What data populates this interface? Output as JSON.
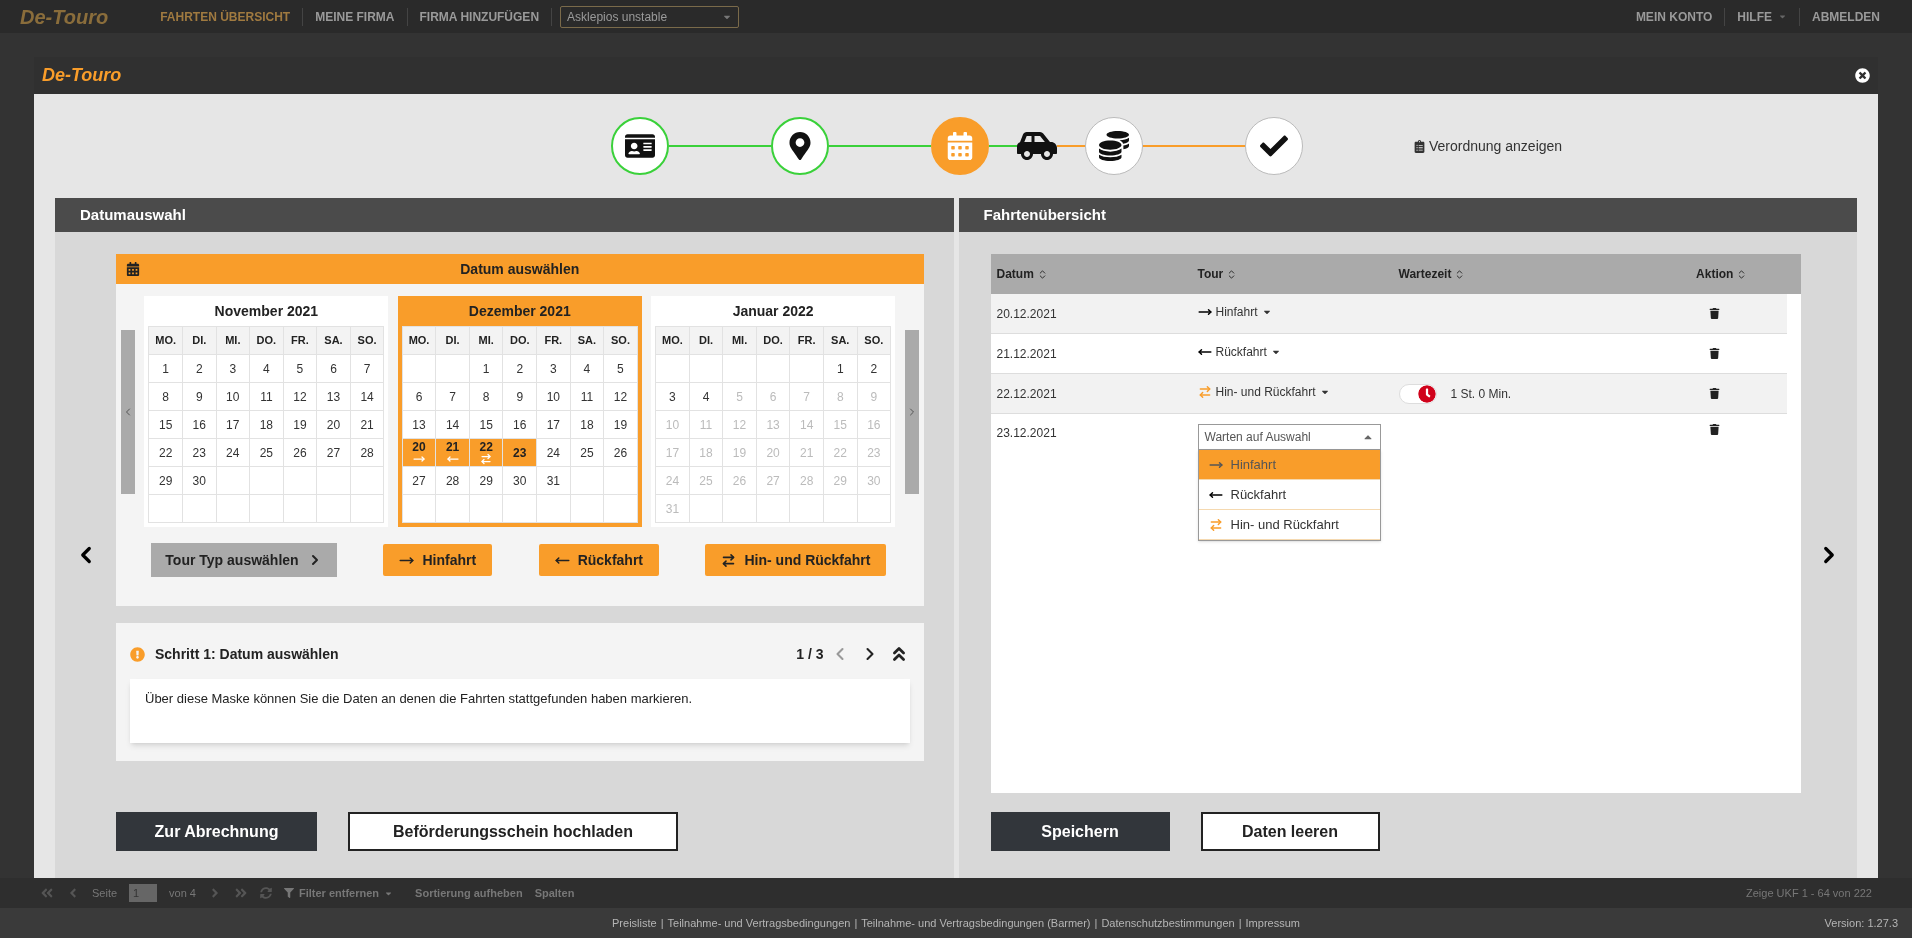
{
  "top_nav": {
    "logo": "De-Touro",
    "links": [
      {
        "label": "FAHRTEN ÜBERSICHT",
        "selected": true
      },
      {
        "label": "MEINE FIRMA",
        "selected": false
      },
      {
        "label": "FIRMA HINZUFÜGEN",
        "selected": false
      }
    ],
    "tenant_select": {
      "value": "Asklepios unstable"
    },
    "right_links": [
      {
        "label": "MEIN KONTO",
        "has_menu": false
      },
      {
        "label": "HILFE",
        "has_menu": true
      },
      {
        "label": "ABMELDEN",
        "has_menu": false
      }
    ]
  },
  "modal": {
    "logo": "De-Touro",
    "stepper": [
      {
        "kind": "circle",
        "done": true,
        "current": false
      },
      {
        "kind": "circle",
        "done": true,
        "current": false
      },
      {
        "kind": "circle",
        "done": false,
        "current": true
      },
      {
        "kind": "plain",
        "done": false,
        "current": true
      },
      {
        "kind": "circle",
        "done": false,
        "current": false
      },
      {
        "kind": "circle",
        "done": false,
        "current": false
      }
    ],
    "prescription_link": "Verordnung anzeigen",
    "left_panel": {
      "title": "Datumauswahl",
      "calendar_title": "Datum auswählen",
      "months": [
        {
          "title": "November 2021",
          "selected": false,
          "weekdays": [
            "MO.",
            "DI.",
            "MI.",
            "DO.",
            "FR.",
            "SA.",
            "SO."
          ],
          "weeks": [
            [
              {
                "kind": "day",
                "day": "1",
                "selected": false,
                "disabled": false
              },
              {
                "kind": "day",
                "day": "2",
                "selected": false,
                "disabled": false
              },
              {
                "kind": "day",
                "day": "3",
                "selected": false,
                "disabled": false
              },
              {
                "kind": "day",
                "day": "4",
                "selected": false,
                "disabled": false
              },
              {
                "kind": "day",
                "day": "5",
                "selected": false,
                "disabled": false
              },
              {
                "kind": "day",
                "day": "6",
                "selected": false,
                "disabled": false
              },
              {
                "kind": "day",
                "day": "7",
                "selected": false,
                "disabled": false
              }
            ],
            [
              {
                "kind": "day",
                "day": "8",
                "selected": false,
                "disabled": false
              },
              {
                "kind": "day",
                "day": "9",
                "selected": false,
                "disabled": false
              },
              {
                "kind": "day",
                "day": "10",
                "selected": false,
                "disabled": false
              },
              {
                "kind": "day",
                "day": "11",
                "selected": false,
                "disabled": false
              },
              {
                "kind": "day",
                "day": "12",
                "selected": false,
                "disabled": false
              },
              {
                "kind": "day",
                "day": "13",
                "selected": false,
                "disabled": false
              },
              {
                "kind": "day",
                "day": "14",
                "selected": false,
                "disabled": false
              }
            ],
            [
              {
                "kind": "day",
                "day": "15",
                "selected": false,
                "disabled": false
              },
              {
                "kind": "day",
                "day": "16",
                "selected": false,
                "disabled": false
              },
              {
                "kind": "day",
                "day": "17",
                "selected": false,
                "disabled": false
              },
              {
                "kind": "day",
                "day": "18",
                "selected": false,
                "disabled": false
              },
              {
                "kind": "day",
                "day": "19",
                "selected": false,
                "disabled": false
              },
              {
                "kind": "day",
                "day": "20",
                "selected": false,
                "disabled": false
              },
              {
                "kind": "day",
                "day": "21",
                "selected": false,
                "disabled": false
              }
            ],
            [
              {
                "kind": "day",
                "day": "22",
                "selected": false,
                "disabled": false
              },
              {
                "kind": "day",
                "day": "23",
                "selected": false,
                "disabled": false
              },
              {
                "kind": "day",
                "day": "24",
                "selected": false,
                "disabled": false
              },
              {
                "kind": "day",
                "day": "25",
                "selected": false,
                "disabled": false
              },
              {
                "kind": "day",
                "day": "26",
                "selected": false,
                "disabled": false
              },
              {
                "kind": "day",
                "day": "27",
                "selected": false,
                "disabled": false
              },
              {
                "kind": "day",
                "day": "28",
                "selected": false,
                "disabled": false
              }
            ],
            [
              {
                "kind": "day",
                "day": "29",
                "selected": false,
                "disabled": false
              },
              {
                "kind": "day",
                "day": "30",
                "selected": false,
                "disabled": false
              },
              {
                "kind": "blank"
              },
              {
                "kind": "blank"
              },
              {
                "kind": "blank"
              },
              {
                "kind": "blank"
              },
              {
                "kind": "blank"
              }
            ],
            [
              {
                "kind": "blank"
              },
              {
                "kind": "blank"
              },
              {
                "kind": "blank"
              },
              {
                "kind": "blank"
              },
              {
                "kind": "blank"
              },
              {
                "kind": "blank"
              },
              {
                "kind": "blank"
              }
            ]
          ]
        },
        {
          "title": "Dezember 2021",
          "selected": true,
          "weekdays": [
            "MO.",
            "DI.",
            "MI.",
            "DO.",
            "FR.",
            "SA.",
            "SO."
          ],
          "weeks": [
            [
              {
                "kind": "blank"
              },
              {
                "kind": "blank"
              },
              {
                "kind": "day",
                "day": "1",
                "selected": false,
                "disabled": false
              },
              {
                "kind": "day",
                "day": "2",
                "selected": false,
                "disabled": false
              },
              {
                "kind": "day",
                "day": "3",
                "selected": false,
                "disabled": false
              },
              {
                "kind": "day",
                "day": "4",
                "selected": false,
                "disabled": false
              },
              {
                "kind": "day",
                "day": "5",
                "selected": false,
                "disabled": false
              }
            ],
            [
              {
                "kind": "day",
                "day": "6",
                "selected": false,
                "disabled": false
              },
              {
                "kind": "day",
                "day": "7",
                "selected": false,
                "disabled": false
              },
              {
                "kind": "day",
                "day": "8",
                "selected": false,
                "disabled": false
              },
              {
                "kind": "day",
                "day": "9",
                "selected": false,
                "disabled": false
              },
              {
                "kind": "day",
                "day": "10",
                "selected": false,
                "disabled": false
              },
              {
                "kind": "day",
                "day": "11",
                "selected": false,
                "disabled": false
              },
              {
                "kind": "day",
                "day": "12",
                "selected": false,
                "disabled": false
              }
            ],
            [
              {
                "kind": "day",
                "day": "13",
                "selected": false,
                "disabled": false
              },
              {
                "kind": "day",
                "day": "14",
                "selected": false,
                "disabled": false
              },
              {
                "kind": "day",
                "day": "15",
                "selected": false,
                "disabled": false
              },
              {
                "kind": "day",
                "day": "16",
                "selected": false,
                "disabled": false
              },
              {
                "kind": "day",
                "day": "17",
                "selected": false,
                "disabled": false
              },
              {
                "kind": "day",
                "day": "18",
                "selected": false,
                "disabled": false
              },
              {
                "kind": "day",
                "day": "19",
                "selected": false,
                "disabled": false
              }
            ],
            [
              {
                "kind": "outbound",
                "day": "20",
                "selected": true,
                "disabled": false
              },
              {
                "kind": "return",
                "day": "21",
                "selected": true,
                "disabled": false
              },
              {
                "kind": "both",
                "day": "22",
                "selected": true,
                "disabled": false
              },
              {
                "kind": "day",
                "day": "23",
                "selected": true,
                "disabled": false
              },
              {
                "kind": "day",
                "day": "24",
                "selected": false,
                "disabled": false
              },
              {
                "kind": "day",
                "day": "25",
                "selected": false,
                "disabled": false
              },
              {
                "kind": "day",
                "day": "26",
                "selected": false,
                "disabled": false
              }
            ],
            [
              {
                "kind": "day",
                "day": "27",
                "selected": false,
                "disabled": false
              },
              {
                "kind": "day",
                "day": "28",
                "selected": false,
                "disabled": false
              },
              {
                "kind": "day",
                "day": "29",
                "selected": false,
                "disabled": false
              },
              {
                "kind": "day",
                "day": "30",
                "selected": false,
                "disabled": false
              },
              {
                "kind": "day",
                "day": "31",
                "selected": false,
                "disabled": false
              },
              {
                "kind": "blank"
              },
              {
                "kind": "blank"
              }
            ],
            [
              {
                "kind": "blank"
              },
              {
                "kind": "blank"
              },
              {
                "kind": "blank"
              },
              {
                "kind": "blank"
              },
              {
                "kind": "blank"
              },
              {
                "kind": "blank"
              },
              {
                "kind": "blank"
              }
            ]
          ]
        },
        {
          "title": "Januar 2022",
          "selected": false,
          "weekdays": [
            "MO.",
            "DI.",
            "MI.",
            "DO.",
            "FR.",
            "SA.",
            "SO."
          ],
          "weeks": [
            [
              {
                "kind": "blank"
              },
              {
                "kind": "blank"
              },
              {
                "kind": "blank"
              },
              {
                "kind": "blank"
              },
              {
                "kind": "blank"
              },
              {
                "kind": "day",
                "day": "1",
                "selected": false,
                "disabled": false
              },
              {
                "kind": "day",
                "day": "2",
                "selected": false,
                "disabled": false
              }
            ],
            [
              {
                "kind": "day",
                "day": "3",
                "selected": false,
                "disabled": false
              },
              {
                "kind": "day",
                "day": "4",
                "selected": false,
                "disabled": false
              },
              {
                "kind": "day",
                "day": "5",
                "selected": false,
                "disabled": true
              },
              {
                "kind": "day",
                "day": "6",
                "selected": false,
                "disabled": true
              },
              {
                "kind": "day",
                "day": "7",
                "selected": false,
                "disabled": true
              },
              {
                "kind": "day",
                "day": "8",
                "selected": false,
                "disabled": true
              },
              {
                "kind": "day",
                "day": "9",
                "selected": false,
                "disabled": true
              }
            ],
            [
              {
                "kind": "day",
                "day": "10",
                "selected": false,
                "disabled": true
              },
              {
                "kind": "day",
                "day": "11",
                "selected": false,
                "disabled": true
              },
              {
                "kind": "day",
                "day": "12",
                "selected": false,
                "disabled": true
              },
              {
                "kind": "day",
                "day": "13",
                "selected": false,
                "disabled": true
              },
              {
                "kind": "day",
                "day": "14",
                "selected": false,
                "disabled": true
              },
              {
                "kind": "day",
                "day": "15",
                "selected": false,
                "disabled": true
              },
              {
                "kind": "day",
                "day": "16",
                "selected": false,
                "disabled": true
              }
            ],
            [
              {
                "kind": "day",
                "day": "17",
                "selected": false,
                "disabled": true
              },
              {
                "kind": "day",
                "day": "18",
                "selected": false,
                "disabled": true
              },
              {
                "kind": "day",
                "day": "19",
                "selected": false,
                "disabled": true
              },
              {
                "kind": "day",
                "day": "20",
                "selected": false,
                "disabled": true
              },
              {
                "kind": "day",
                "day": "21",
                "selected": false,
                "disabled": true
              },
              {
                "kind": "day",
                "day": "22",
                "selected": false,
                "disabled": true
              },
              {
                "kind": "day",
                "day": "23",
                "selected": false,
                "disabled": true
              }
            ],
            [
              {
                "kind": "day",
                "day": "24",
                "selected": false,
                "disabled": true
              },
              {
                "kind": "day",
                "day": "25",
                "selected": false,
                "disabled": true
              },
              {
                "kind": "day",
                "day": "26",
                "selected": false,
                "disabled": true
              },
              {
                "kind": "day",
                "day": "27",
                "selected": false,
                "disabled": true
              },
              {
                "kind": "day",
                "day": "28",
                "selected": false,
                "disabled": true
              },
              {
                "kind": "day",
                "day": "29",
                "selected": false,
                "disabled": true
              },
              {
                "kind": "day",
                "day": "30",
                "selected": false,
                "disabled": true
              }
            ],
            [
              {
                "kind": "day",
                "day": "31",
                "selected": false,
                "disabled": true
              },
              {
                "kind": "blank"
              },
              {
                "kind": "blank"
              },
              {
                "kind": "blank"
              },
              {
                "kind": "blank"
              },
              {
                "kind": "blank"
              },
              {
                "kind": "blank"
              }
            ]
          ]
        }
      ],
      "tour_buttons": [
        {
          "label": "Tour Typ auswählen",
          "kind": "menu"
        },
        {
          "label": "Hinfahrt",
          "kind": "outbound"
        },
        {
          "label": "Rückfahrt",
          "kind": "return"
        },
        {
          "label": "Hin- und Rückfahrt",
          "kind": "both"
        }
      ],
      "help": {
        "title": "Schritt 1: Datum auswählen",
        "pager": "1 / 3",
        "prev_disabled": true,
        "text": "Über diese Maske können Sie die Daten an denen die Fahrten stattgefunden haben markieren."
      },
      "buttons": [
        {
          "label": "Zur Abrechnung",
          "kind": "primary"
        },
        {
          "label": "Beförderungsschein hochladen",
          "kind": "outline"
        }
      ]
    },
    "right_panel": {
      "title": "Fahrtenübersicht",
      "columns": [
        "Datum",
        "Tour",
        "Wartezeit",
        "Aktion"
      ],
      "rows": [
        {
          "date": "20.12.2021",
          "kind": "outbound",
          "tour_label": "Hinfahrt"
        },
        {
          "date": "21.12.2021",
          "kind": "return",
          "tour_label": "Rückfahrt"
        },
        {
          "date": "22.12.2021",
          "kind": "both",
          "tour_label": "Hin- und Rückfahrt",
          "wait": {
            "on": true,
            "text": "1 St. 0 Min."
          }
        },
        {
          "date": "23.12.2021",
          "kind": "select",
          "placeholder": "Warten auf Auswahl",
          "expanded": true,
          "options": [
            {
              "kind": "outbound",
              "label": "Hinfahrt",
              "selected": true
            },
            {
              "kind": "return",
              "label": "Rückfahrt",
              "selected": false
            },
            {
              "kind": "both",
              "label": "Hin- und Rückfahrt",
              "selected": false
            }
          ]
        }
      ],
      "buttons": [
        {
          "label": "Speichern",
          "kind": "primary"
        },
        {
          "label": "Daten leeren",
          "kind": "outline"
        }
      ]
    }
  },
  "pager_bar": {
    "page_label": "Seite",
    "page": "1",
    "of": "von 4",
    "filter": "Filter entfernen",
    "sort": "Sortierung aufheben",
    "columns": "Spalten",
    "summary": "Zeige UKF 1 - 64 von 222"
  },
  "footer": {
    "links": [
      "Preisliste",
      "Teilnahme- und Vertragsbedingungen",
      "Teilnahme- und Vertragsbedingungen (Barmer)",
      "Datenschutzbestimmungen",
      "Impressum"
    ],
    "separator": "|",
    "version": "Version: 1.27.3"
  }
}
